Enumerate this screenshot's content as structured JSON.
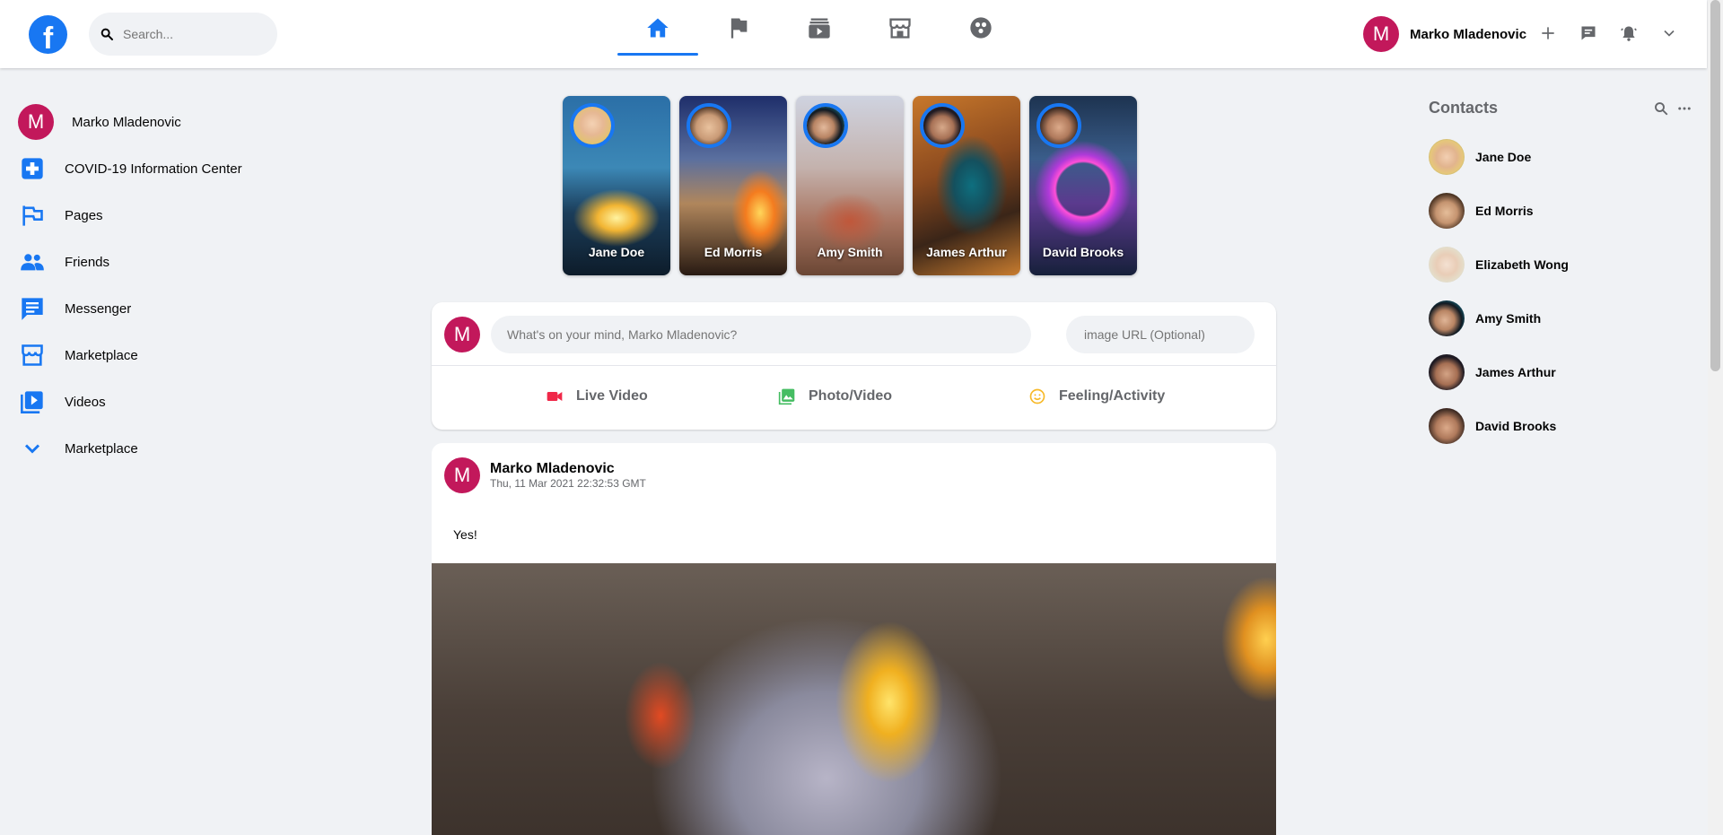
{
  "header": {
    "logo": "f",
    "search_placeholder": "Search...",
    "nav_tabs": [
      {
        "name": "home",
        "icon": "home-icon",
        "active": true
      },
      {
        "name": "pages",
        "icon": "flag-icon",
        "active": false
      },
      {
        "name": "watch",
        "icon": "video-icon",
        "active": false
      },
      {
        "name": "marketplace",
        "icon": "store-icon",
        "active": false
      },
      {
        "name": "groups",
        "icon": "groups-icon",
        "active": false
      }
    ],
    "user_initial": "M",
    "user_name": "Marko Mladenovic",
    "actions": [
      "plus-icon",
      "messenger-icon",
      "bell-icon",
      "chevron-down-icon"
    ]
  },
  "sidebar": {
    "items": [
      {
        "label": "Marko Mladenovic",
        "icon": "avatar"
      },
      {
        "label": "COVID-19 Information Center",
        "icon": "medical-plus-icon"
      },
      {
        "label": "Pages",
        "icon": "flag-icon"
      },
      {
        "label": "Friends",
        "icon": "people-icon"
      },
      {
        "label": "Messenger",
        "icon": "chat-icon"
      },
      {
        "label": "Marketplace",
        "icon": "store-icon"
      },
      {
        "label": "Videos",
        "icon": "video-library-icon"
      },
      {
        "label": "Marketplace",
        "icon": "chevron-down-icon"
      }
    ]
  },
  "stories": [
    {
      "name": "Jane Doe"
    },
    {
      "name": "Ed Morris"
    },
    {
      "name": "Amy Smith"
    },
    {
      "name": "James Arthur"
    },
    {
      "name": "David Brooks"
    }
  ],
  "composer": {
    "avatar_initial": "M",
    "placeholder": "What's on your mind, Marko Mladenovic?",
    "image_url_placeholder": "image URL (Optional)",
    "buttons": [
      {
        "label": "Live Video",
        "icon": "live-video-icon",
        "color": "#f02849"
      },
      {
        "label": "Photo/Video",
        "icon": "photo-icon",
        "color": "#45bd62"
      },
      {
        "label": "Feeling/Activity",
        "icon": "smile-icon",
        "color": "#f7b928"
      }
    ]
  },
  "post": {
    "avatar_initial": "M",
    "author": "Marko Mladenovic",
    "timestamp": "Thu, 11 Mar 2021 22:32:53 GMT",
    "text": "Yes!"
  },
  "contacts": {
    "title": "Contacts",
    "list": [
      {
        "name": "Jane Doe"
      },
      {
        "name": "Ed Morris"
      },
      {
        "name": "Elizabeth Wong"
      },
      {
        "name": "Amy Smith"
      },
      {
        "name": "James Arthur"
      },
      {
        "name": "David Brooks"
      }
    ]
  },
  "colors": {
    "brand": "#1877f2",
    "avatar": "#c2185b",
    "background": "#f0f2f5"
  }
}
